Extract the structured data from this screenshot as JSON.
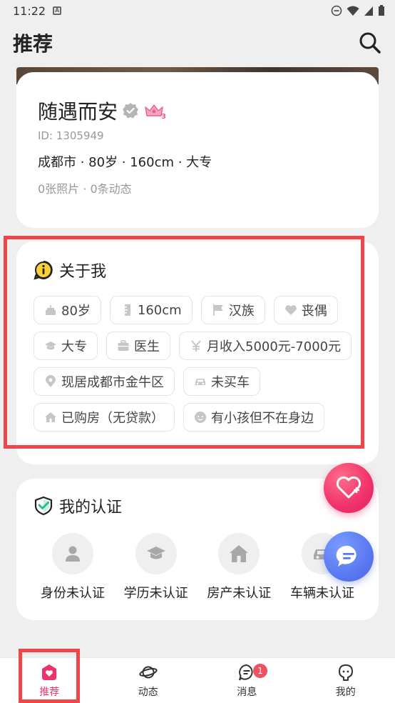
{
  "status_bar": {
    "time": "11:22",
    "notification_icon": "A"
  },
  "header": {
    "title": "推荐"
  },
  "profile": {
    "name": "随遇而安",
    "crown_level": "3",
    "uid": "ID: 1305949",
    "info": "成都市 · 80岁 · 160cm · 大专",
    "counts": "0张照片 · 0条动态"
  },
  "about": {
    "title": "关于我",
    "tags": [
      {
        "icon": "cake-icon",
        "label": "80岁"
      },
      {
        "icon": "height-icon",
        "label": "160cm"
      },
      {
        "icon": "flag-icon",
        "label": "汉族"
      },
      {
        "icon": "heart-icon",
        "label": "丧偶"
      },
      {
        "icon": "graduation-cap-icon",
        "label": "大专"
      },
      {
        "icon": "briefcase-icon",
        "label": "医生"
      },
      {
        "icon": "yen-icon",
        "label": "月收入5000元-7000元"
      },
      {
        "icon": "location-pin-icon",
        "label": "现居成都市金牛区"
      },
      {
        "icon": "car-icon",
        "label": "未买车"
      },
      {
        "icon": "house-icon",
        "label": "已购房（无贷款）"
      },
      {
        "icon": "child-face-icon",
        "label": "有小孩但不在身边"
      }
    ]
  },
  "certification": {
    "title": "我的认证",
    "items": [
      {
        "icon": "person-icon",
        "label": "身份未认证"
      },
      {
        "icon": "graduation-cap-icon",
        "label": "学历未认证"
      },
      {
        "icon": "house-icon",
        "label": "房产未认证"
      },
      {
        "icon": "car-icon",
        "label": "车辆未认证"
      }
    ]
  },
  "nav": {
    "items": [
      {
        "label": "推荐",
        "icon": "home-heart-icon",
        "active": true
      },
      {
        "label": "动态",
        "icon": "planet-icon",
        "active": false
      },
      {
        "label": "消息",
        "icon": "message-icon",
        "active": false,
        "badge": "1"
      },
      {
        "label": "我的",
        "icon": "profile-icon",
        "active": false
      }
    ]
  },
  "colors": {
    "accent": "#f0326a",
    "highlight": "#f0464a",
    "chat_fab": "#5a79f0",
    "badge": "#f05060"
  }
}
